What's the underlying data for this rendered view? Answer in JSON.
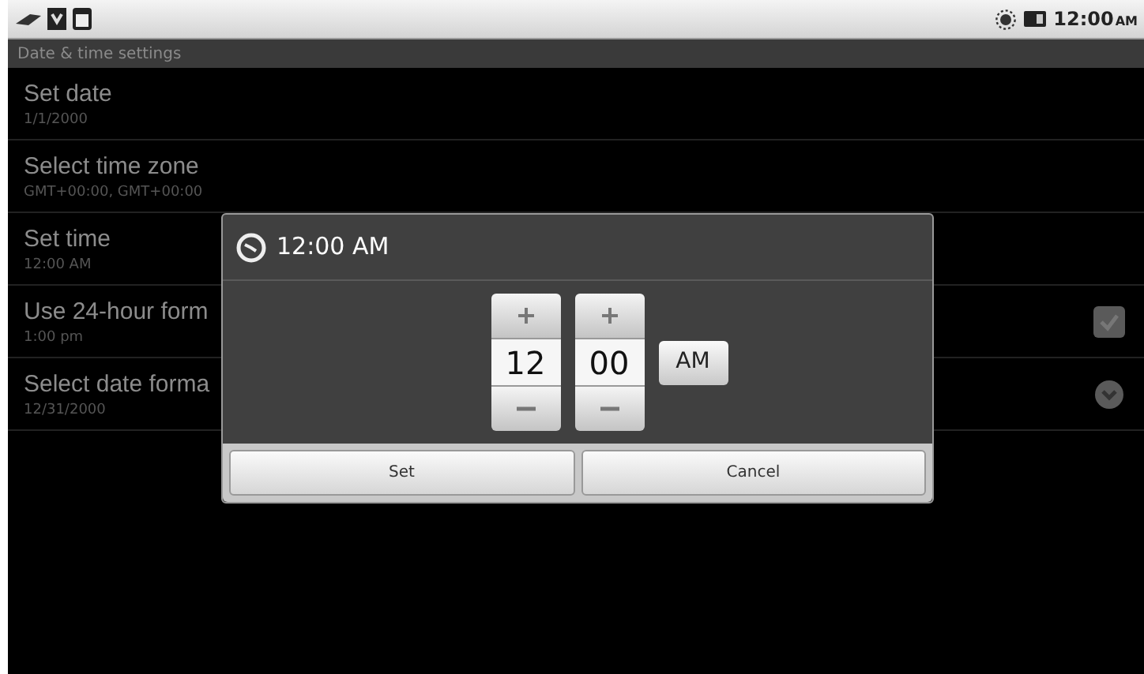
{
  "status_bar": {
    "time": "12:00",
    "time_suffix": "AM"
  },
  "title": "Date & time settings",
  "settings": [
    {
      "kind": "plain",
      "label": "Set date",
      "summary": "1/1/2000"
    },
    {
      "kind": "plain",
      "label": "Select time zone",
      "summary": "GMT+00:00, GMT+00:00"
    },
    {
      "kind": "plain",
      "label": "Set time",
      "summary": "12:00 AM"
    },
    {
      "kind": "checkbox",
      "label": "Use 24-hour form",
      "summary": "1:00 pm",
      "checked": true
    },
    {
      "kind": "dropdown",
      "label": "Select date forma",
      "summary": "12/31/2000"
    }
  ],
  "dialog": {
    "title": "12:00 AM",
    "hour": "12",
    "minute": "00",
    "ampm": "AM",
    "buttons": [
      "Set",
      "Cancel"
    ]
  }
}
